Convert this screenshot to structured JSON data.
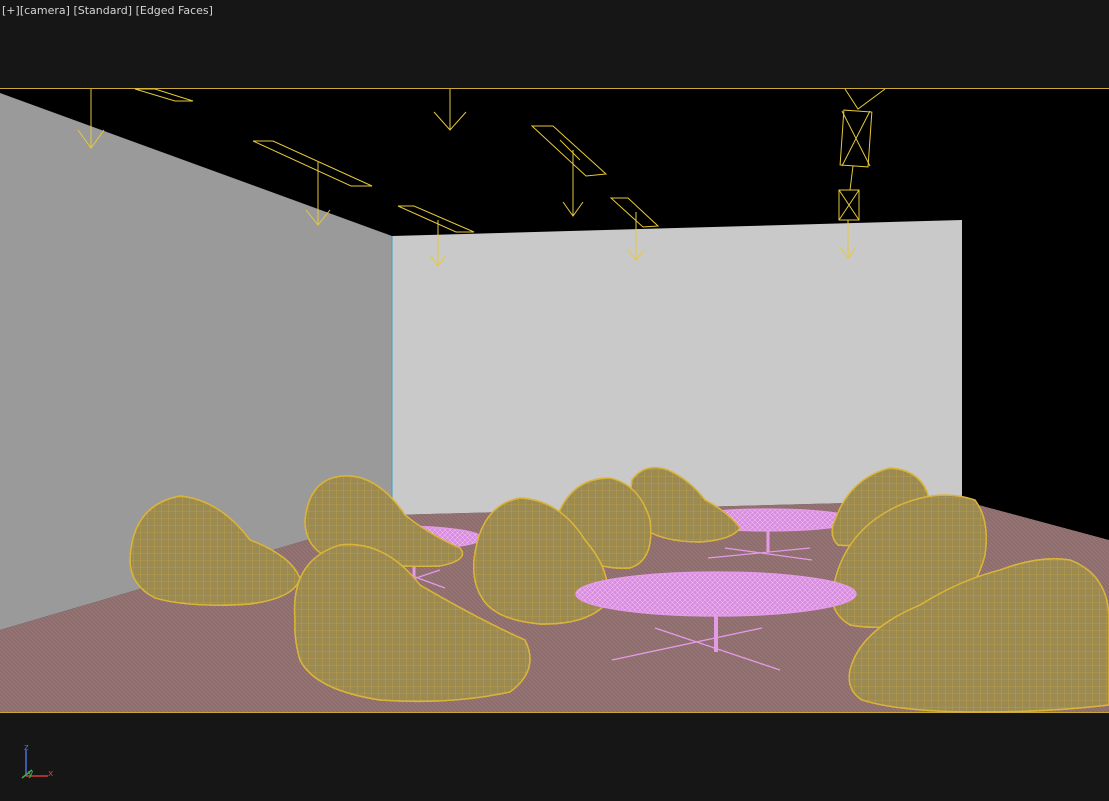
{
  "viewport": {
    "label_plus": "[+]",
    "label_camera": "[camera]",
    "label_shading": "[Standard]",
    "label_edged": "[Edged Faces]"
  },
  "axis": {
    "z_label": "z",
    "y_label": "y",
    "x_label": "x",
    "z_color": "#4a6fd6",
    "y_color": "#3fb24a",
    "x_color": "#d43a3a"
  },
  "colors": {
    "background": "#161616",
    "render_frame": "#000000",
    "safe_frame_line": "#c9a83a",
    "left_wall": "#9a9a9a",
    "back_wall": "#c9c9c9",
    "floor": "#8a6a6a",
    "light_gizmo": "#e6c93a",
    "chair_fill": "#9b8a52",
    "chair_wire": "#d9b43a",
    "table_wire": "#e59ae8"
  },
  "scene": {
    "objects": [
      "camera-target",
      "ceiling-lights",
      "left-wall",
      "back-wall",
      "floor",
      "bean-bag-chairs",
      "coffee-tables"
    ]
  }
}
